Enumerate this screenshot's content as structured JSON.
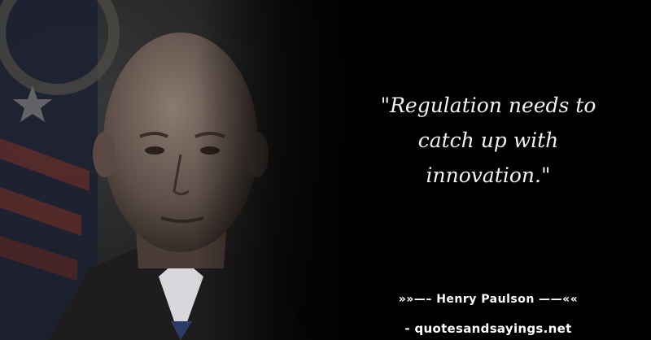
{
  "quote": {
    "line1": "\"Regulation needs to",
    "line2": "catch up with",
    "line3": "innovation.\""
  },
  "attribution": "»»—– Henry Paulson ——««",
  "source": "- quotesandsayings.net",
  "colors": {
    "background": "#000000",
    "text": "#f2f2f2"
  }
}
